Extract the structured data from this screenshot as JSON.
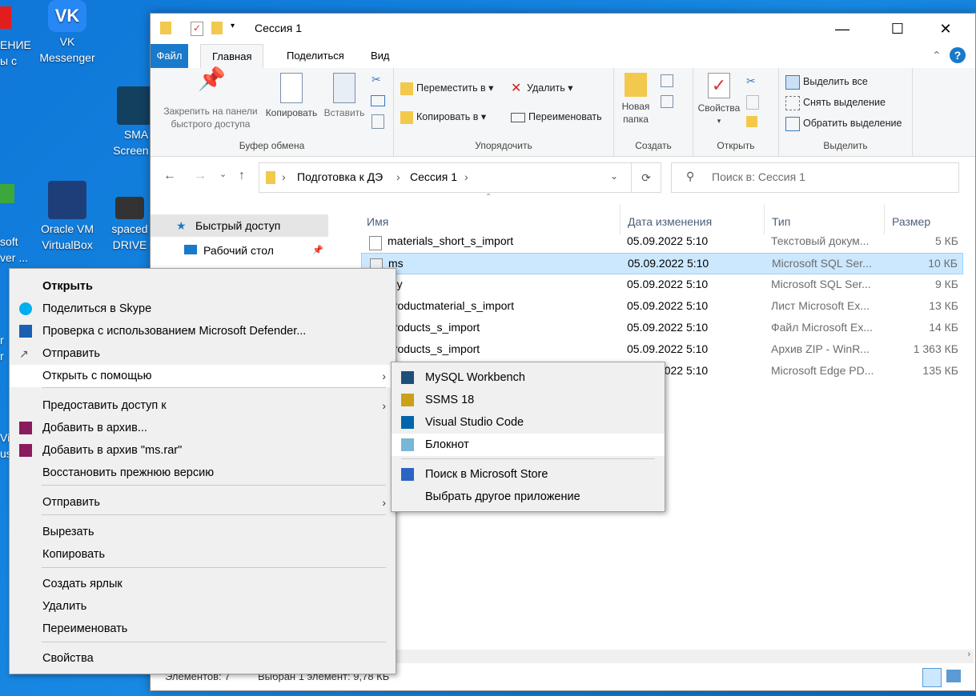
{
  "desktop": {
    "icons": [
      {
        "label1": "VK",
        "label2": "Messenger"
      },
      {
        "label1": "SMA",
        "label2": "Screen S"
      },
      {
        "label1": "Oracle VM",
        "label2": "VirtualBox"
      },
      {
        "label1": "spaced",
        "label2": "DRIVE"
      }
    ],
    "partials": [
      "ЕНИЕ",
      "ы с",
      "soft",
      "ver ...",
      "r",
      "r",
      "Vi",
      "us"
    ]
  },
  "window": {
    "title": "Сессия 1",
    "tabs": [
      "Файл",
      "Главная",
      "Поделиться",
      "Вид"
    ],
    "ribbon": {
      "clipboard": {
        "pin": "Закрепить на панели быстрого доступа",
        "copy": "Копировать",
        "paste": "Вставить",
        "label": "Буфер обмена"
      },
      "organize": {
        "move": "Переместить в",
        "copyto": "Копировать в",
        "delete": "Удалить",
        "rename": "Переименовать",
        "label": "Упорядочить"
      },
      "create": {
        "newfolder": "Новая папка",
        "label": "Создать"
      },
      "open": {
        "props": "Свойства",
        "label": "Открыть"
      },
      "select": {
        "all": "Выделить все",
        "none": "Снять выделение",
        "invert": "Обратить выделение",
        "label": "Выделить"
      }
    },
    "address": [
      "Подготовка к ДЭ",
      "Сессия 1"
    ],
    "search_placeholder": "Поиск в: Сессия 1",
    "nav": {
      "quick": "Быстрый доступ",
      "desktop": "Рабочий стол"
    },
    "columns": {
      "name": "Имя",
      "date": "Дата изменения",
      "type": "Тип",
      "size": "Размер"
    },
    "files": [
      {
        "name": "materials_short_s_import",
        "date": "05.09.2022 5:10",
        "type": "Текстовый докум...",
        "size": "5 КБ"
      },
      {
        "name": "ms",
        "date": "05.09.2022 5:10",
        "type": "Microsoft SQL Ser...",
        "size": "10 КБ"
      },
      {
        "name": "my",
        "date": "05.09.2022 5:10",
        "type": "Microsoft SQL Ser...",
        "size": "9 КБ"
      },
      {
        "name": "productmaterial_s_import",
        "date": "05.09.2022 5:10",
        "type": "Лист Microsoft Ex...",
        "size": "13 КБ"
      },
      {
        "name": "products_s_import",
        "date": "05.09.2022 5:10",
        "type": "Файл Microsoft Ex...",
        "size": "14 КБ"
      },
      {
        "name": "products_s_import",
        "date": "05.09.2022 5:10",
        "type": "Архив ZIP - WinR...",
        "size": "1 363 КБ"
      },
      {
        "name": "",
        "date": "05.09.2022 5:10",
        "type": "Microsoft Edge PD...",
        "size": "135 КБ"
      }
    ],
    "status": {
      "count": "Элементов: 7",
      "selected": "Выбран 1 элемент: 9,78 КБ"
    }
  },
  "context_menu": {
    "items": [
      "Открыть",
      "Поделиться в Skype",
      "Проверка с использованием Microsoft Defender...",
      "Отправить",
      "Открыть с помощью",
      "Предоставить доступ к",
      "Добавить в архив...",
      "Добавить в архив \"ms.rar\"",
      "Восстановить прежнюю версию",
      "Отправить",
      "Вырезать",
      "Копировать",
      "Создать ярлык",
      "Удалить",
      "Переименовать",
      "Свойства"
    ]
  },
  "submenu": {
    "items": [
      "MySQL Workbench",
      "SSMS 18",
      "Visual Studio Code",
      "Блокнот",
      "Поиск в Microsoft Store",
      "Выбрать другое приложение"
    ]
  }
}
